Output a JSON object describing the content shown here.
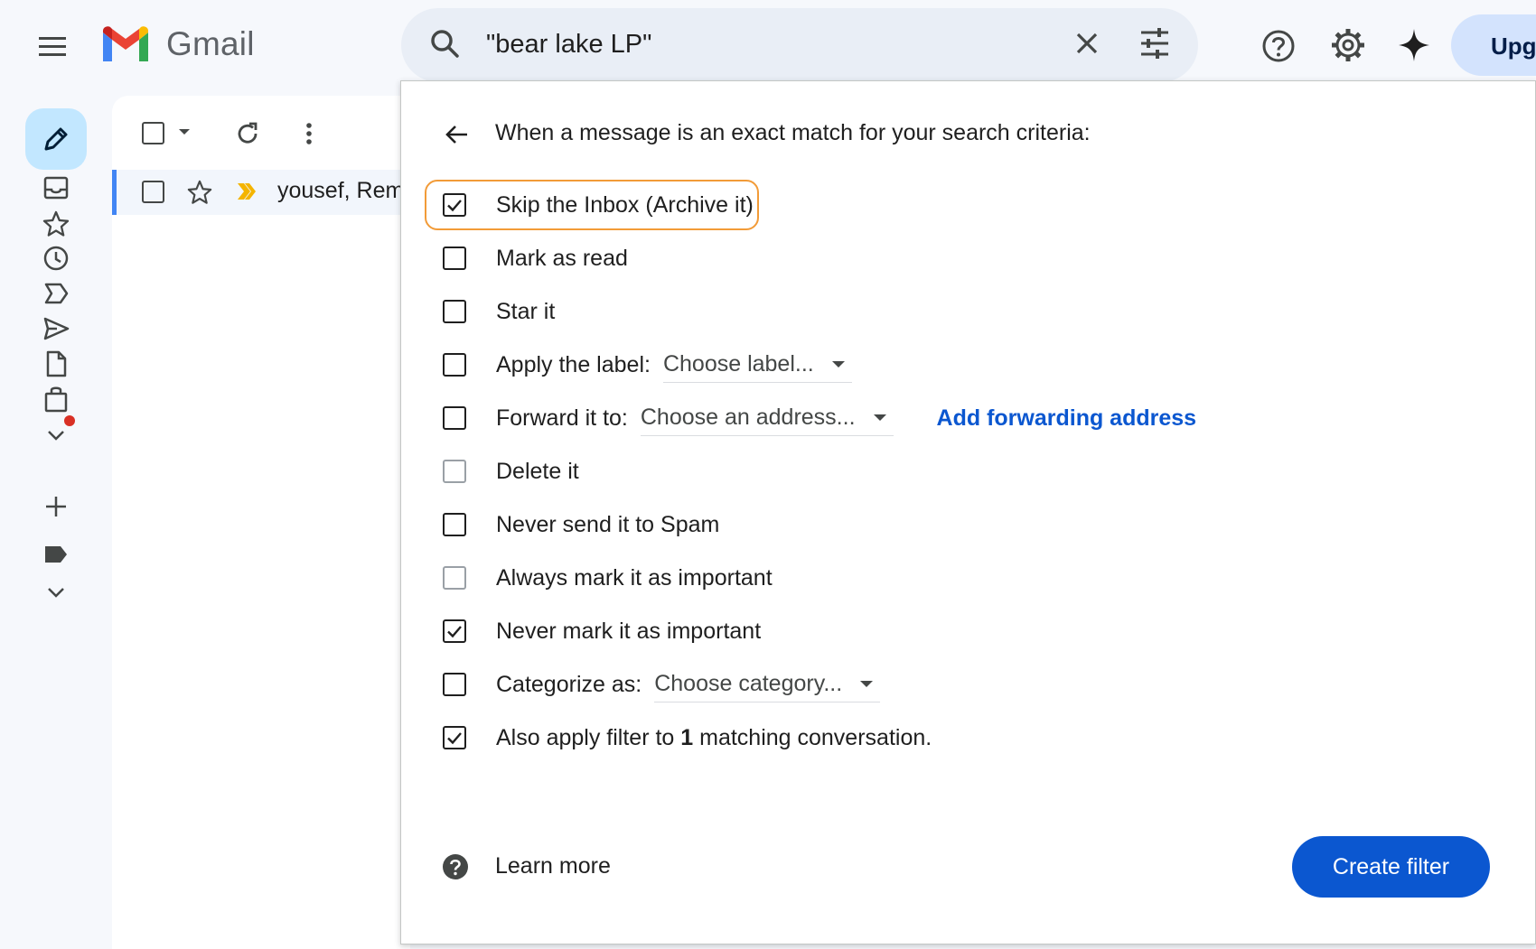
{
  "app": {
    "name": "Gmail"
  },
  "search": {
    "query": "\"bear lake LP\""
  },
  "header": {
    "upgrade_label": "Upgrade"
  },
  "mail_list": {
    "rows": [
      {
        "sender": "yousef, Remi"
      }
    ]
  },
  "filter": {
    "title": "When a message is an exact match for your search criteria:",
    "options": [
      {
        "label": "Skip the Inbox (Archive it)",
        "checked": true
      },
      {
        "label": "Mark as read",
        "checked": false
      },
      {
        "label": "Star it",
        "checked": false
      },
      {
        "label": "Apply the label:",
        "checked": false,
        "select": "Choose label..."
      },
      {
        "label": "Forward it to:",
        "checked": false,
        "select": "Choose an address...",
        "link": "Add forwarding address"
      },
      {
        "label": "Delete it",
        "checked": false
      },
      {
        "label": "Never send it to Spam",
        "checked": false
      },
      {
        "label": "Always mark it as important",
        "checked": false
      },
      {
        "label": "Never mark it as important",
        "checked": true
      },
      {
        "label": "Categorize as:",
        "checked": false,
        "select": "Choose category..."
      },
      {
        "label_pre": "Also apply filter to ",
        "label_bold": "1",
        "label_post": " matching conversation.",
        "checked": true
      }
    ],
    "learn_more": "Learn more",
    "create_label": "Create filter"
  },
  "colors": {
    "accent": "#0b57d0",
    "highlight": "#f29b38",
    "compose_bg": "#c2e7ff",
    "search_bg": "#e9eef6"
  }
}
